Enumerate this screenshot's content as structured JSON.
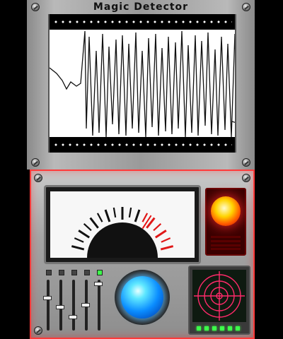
{
  "title": "Magic Detector",
  "colors": {
    "accent_red": "#ff3a3a",
    "lamp": "#ffd400",
    "button_blue": "#0a8cff",
    "radar": "#ff2a6a",
    "led_green": "#3cff4a"
  },
  "icons": [
    "rivet-icon",
    "needle-icon",
    "warning-lamp-icon",
    "detect-button-icon",
    "radar-icon"
  ],
  "meter": {
    "needle_level": 0.72
  },
  "sliders": {
    "levels": [
      0.35,
      0.55,
      0.75,
      0.5,
      0.05
    ]
  },
  "leds": {
    "count": 6
  }
}
